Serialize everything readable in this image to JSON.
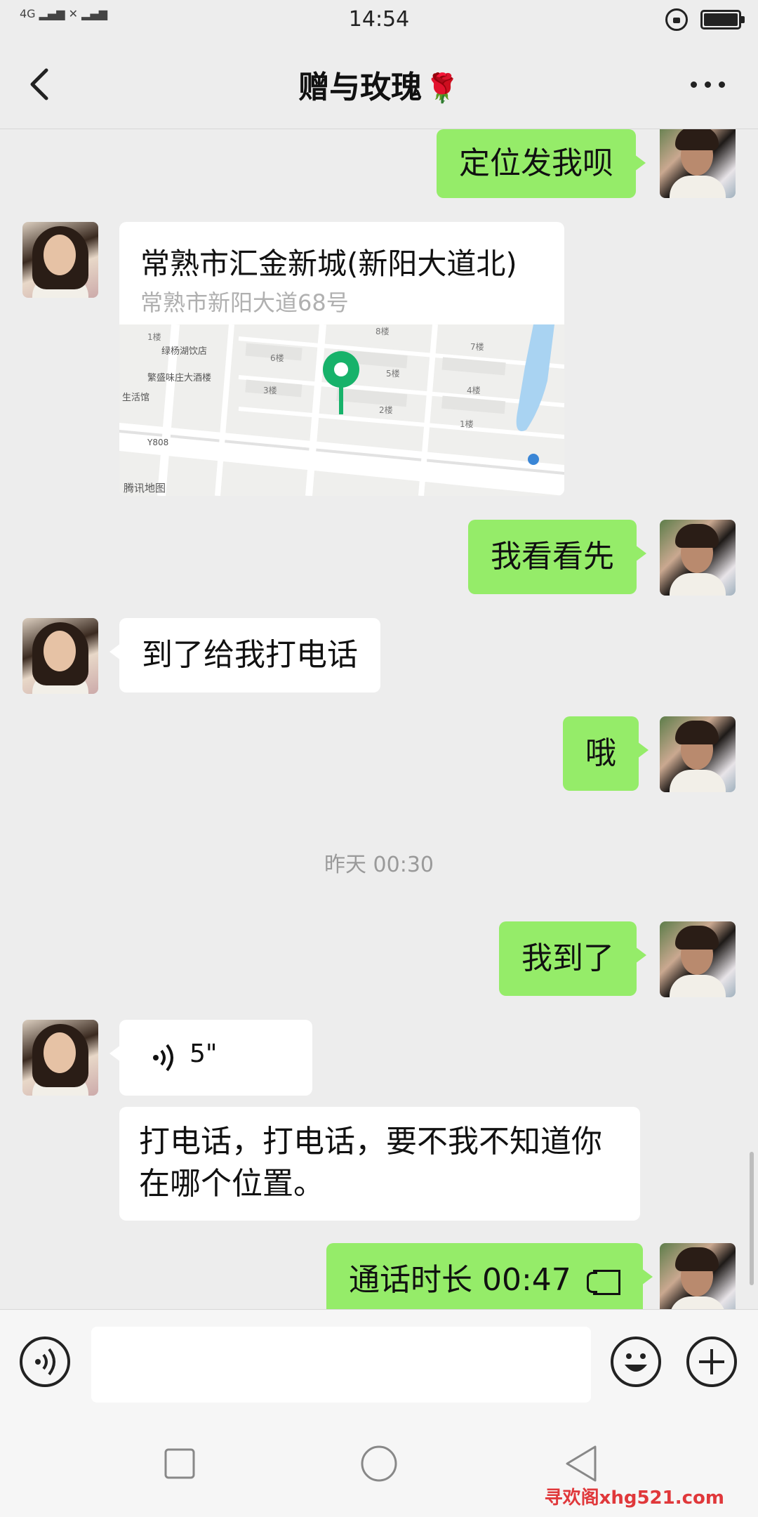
{
  "status_bar": {
    "signal": "4G",
    "time": "14:54"
  },
  "nav": {
    "title": "赠与玫瑰",
    "title_emoji": "🌹"
  },
  "messages": {
    "m1": "定位发我呗",
    "location": {
      "name": "常熟市汇金新城(新阳大道北)",
      "address": "常熟市新阳大道68号",
      "map_labels": [
        "1楼",
        "绿杨湖饮店",
        "6楼",
        "8楼",
        "7楼",
        "5楼",
        "4楼",
        "3楼",
        "2楼",
        "1楼",
        "繁盛味庄大酒楼",
        "生活馆",
        "Y808",
        "腾讯地图"
      ]
    },
    "m3": "我看看先",
    "m4": "到了给我打电话",
    "m5": "哦",
    "timestamp": "昨天 00:30",
    "m6": "我到了",
    "voice_duration": "5\"",
    "m8": "打电话，打电话，要不我不知道你在哪个位置。",
    "call_text": "通话时长 00:47"
  },
  "watermark": "寻欢阁xhg521.com",
  "colors": {
    "mine_bubble": "#95ec69",
    "theirs_bubble": "#ffffff",
    "background": "#ededed",
    "map_pin": "#17b26a"
  }
}
